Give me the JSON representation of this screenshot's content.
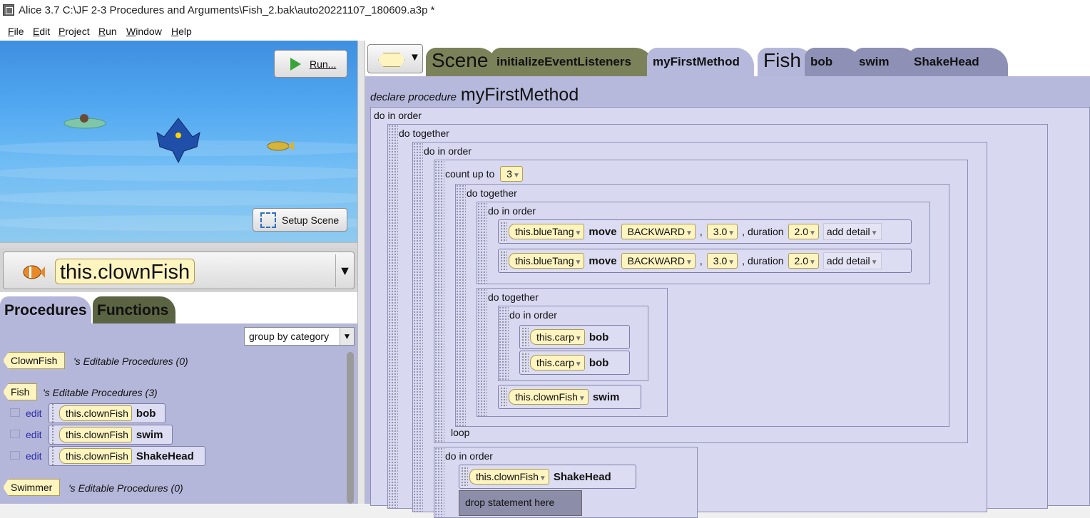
{
  "window": {
    "title": "Alice 3.7 C:\\JF 2-3 Procedures and Arguments\\Fish_2.bak\\auto20221107_180609.a3p *"
  },
  "menu": [
    {
      "label": "File",
      "mnemonic": "F",
      "rest": "ile"
    },
    {
      "label": "Edit",
      "mnemonic": "E",
      "rest": "dit"
    },
    {
      "label": "Project",
      "mnemonic": "P",
      "rest": "roject"
    },
    {
      "label": "Run",
      "mnemonic": "R",
      "rest": "un"
    },
    {
      "label": "Window",
      "mnemonic": "W",
      "rest": "indow"
    },
    {
      "label": "Help",
      "mnemonic": "H",
      "rest": "elp"
    }
  ],
  "scene_view": {
    "run_label": "Run...",
    "setup_scene_label": "Setup Scene"
  },
  "instance_selector": {
    "selected": "this.clownFish",
    "arrow": "▼"
  },
  "left_tabs": {
    "procedures": "Procedures",
    "functions": "Functions"
  },
  "procedures_panel": {
    "group_select_value": "group by category",
    "edit_label": "edit",
    "groups": [
      {
        "class_name": "ClownFish",
        "label": "'s Editable Procedures (0)",
        "items": []
      },
      {
        "class_name": "Fish",
        "label": "'s Editable Procedures (3)",
        "items": [
          {
            "object": "this.clownFish",
            "name": "bob"
          },
          {
            "object": "this.clownFish",
            "name": "swim"
          },
          {
            "object": "this.clownFish",
            "name": "ShakeHead"
          }
        ]
      },
      {
        "class_name": "Swimmer",
        "label": "'s Editable Procedures (0)",
        "items": []
      }
    ]
  },
  "editor_tabs": {
    "scene": "Scene",
    "initialize": "initializeEventListeners",
    "my_first_method": "myFirstMethod",
    "fish": "Fish",
    "bob": "bob",
    "swim": "swim",
    "shake_head": "ShakeHead"
  },
  "colors": {
    "editor_bg": "#b7b9dc",
    "chip_yellow": "#fdf4c0",
    "functions_tab": "#5a6342",
    "scene_tab": "#7b8259"
  },
  "code": {
    "declare_keyword": "declare procedure",
    "method_name": "myFirstMethod",
    "do_in_order": "do in order",
    "do_together": "do together",
    "count_up_to": "count up to",
    "count_value": "3",
    "loop": "loop",
    "move_stmt": {
      "object": "this.blueTang",
      "verb": "move",
      "direction": "BACKWARD",
      "comma": ",",
      "amount": "3.0",
      "duration_label": ", duration",
      "duration": "2.0",
      "add_detail": "add detail"
    },
    "carp_object": "this.carp",
    "bob": "bob",
    "clownfish_object": "this.clownFish",
    "swim": "swim",
    "shake_head": "ShakeHead",
    "drop_here": "drop statement here"
  }
}
